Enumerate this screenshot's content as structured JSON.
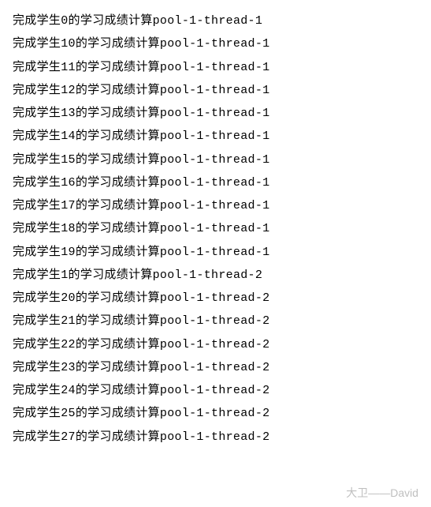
{
  "log_prefix": "完成学生",
  "log_middle": "的学习成绩计算",
  "lines": [
    {
      "student": "0",
      "thread": "pool-1-thread-1"
    },
    {
      "student": "10",
      "thread": "pool-1-thread-1"
    },
    {
      "student": "11",
      "thread": "pool-1-thread-1"
    },
    {
      "student": "12",
      "thread": "pool-1-thread-1"
    },
    {
      "student": "13",
      "thread": "pool-1-thread-1"
    },
    {
      "student": "14",
      "thread": "pool-1-thread-1"
    },
    {
      "student": "15",
      "thread": "pool-1-thread-1"
    },
    {
      "student": "16",
      "thread": "pool-1-thread-1"
    },
    {
      "student": "17",
      "thread": "pool-1-thread-1"
    },
    {
      "student": "18",
      "thread": "pool-1-thread-1"
    },
    {
      "student": "19",
      "thread": "pool-1-thread-1"
    },
    {
      "student": "1",
      "thread": "pool-1-thread-2"
    },
    {
      "student": "20",
      "thread": "pool-1-thread-2"
    },
    {
      "student": "21",
      "thread": "pool-1-thread-2"
    },
    {
      "student": "22",
      "thread": "pool-1-thread-2"
    },
    {
      "student": "23",
      "thread": "pool-1-thread-2"
    },
    {
      "student": "24",
      "thread": "pool-1-thread-2"
    },
    {
      "student": "25",
      "thread": "pool-1-thread-2"
    },
    {
      "student": "27",
      "thread": "pool-1-thread-2"
    }
  ],
  "watermark": "大卫——David"
}
